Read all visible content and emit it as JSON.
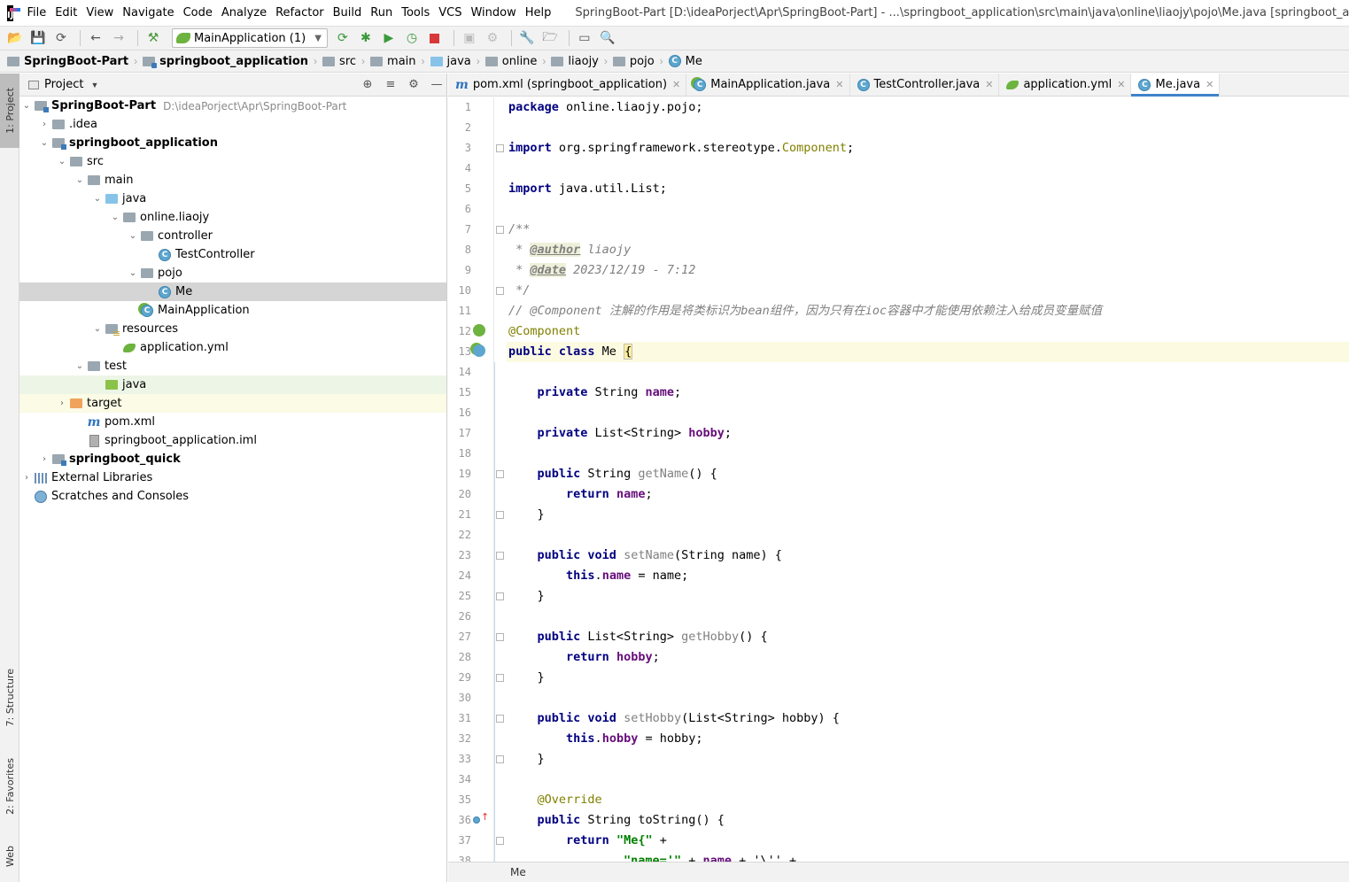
{
  "app": {
    "logo_text": "IJ",
    "window_title": "SpringBoot-Part [D:\\ideaPorject\\Apr\\SpringBoot-Part] - ...\\springboot_application\\src\\main\\java\\online\\liaojy\\pojo\\Me.java [springboot_application] - In"
  },
  "menu": [
    "File",
    "Edit",
    "View",
    "Navigate",
    "Code",
    "Analyze",
    "Refactor",
    "Build",
    "Run",
    "Tools",
    "VCS",
    "Window",
    "Help"
  ],
  "toolbar": {
    "run_config": "MainApplication (1)",
    "icons": [
      "open-icon",
      "save-icon",
      "sync-icon",
      "back-icon",
      "forward-icon",
      "build-icon",
      "run-icon",
      "debug-icon",
      "coverage-icon",
      "profile-icon",
      "stop-icon",
      "attach-icon",
      "sdk-icon",
      "settings-icon",
      "structure-icon",
      "terminal-icon",
      "search-icon"
    ]
  },
  "breadcrumb": [
    "SpringBoot-Part",
    "springboot_application",
    "src",
    "main",
    "java",
    "online",
    "liaojy",
    "pojo",
    "Me"
  ],
  "left_stripe": {
    "project": "1: Project",
    "structure": "7: Structure",
    "favorites": "2: Favorites",
    "web": "Web"
  },
  "project_panel": {
    "title": "Project",
    "tree": [
      {
        "label": "SpringBoot-Part",
        "path": "D:\\ideaPorject\\Apr\\SpringBoot-Part",
        "bold": true
      },
      {
        "label": ".idea"
      },
      {
        "label": "springboot_application",
        "bold": true
      },
      {
        "label": "src"
      },
      {
        "label": "main"
      },
      {
        "label": "java"
      },
      {
        "label": "online.liaojy"
      },
      {
        "label": "controller"
      },
      {
        "label": "TestController"
      },
      {
        "label": "pojo"
      },
      {
        "label": "Me"
      },
      {
        "label": "MainApplication"
      },
      {
        "label": "resources"
      },
      {
        "label": "application.yml"
      },
      {
        "label": "test"
      },
      {
        "label": "java"
      },
      {
        "label": "target"
      },
      {
        "label": "pom.xml"
      },
      {
        "label": "springboot_application.iml"
      },
      {
        "label": "springboot_quick",
        "bold": true
      },
      {
        "label": "External Libraries"
      },
      {
        "label": "Scratches and Consoles"
      }
    ]
  },
  "tabs": [
    {
      "label": "pom.xml (springboot_application)",
      "icon": "maven-icon"
    },
    {
      "label": "MainApplication.java",
      "icon": "spring-class-icon"
    },
    {
      "label": "TestController.java",
      "icon": "class-icon"
    },
    {
      "label": "application.yml",
      "icon": "yaml-icon"
    },
    {
      "label": "Me.java",
      "icon": "class-icon",
      "active": true
    }
  ],
  "code": {
    "l1": "package",
    "l1b": " online.liaojy.pojo;",
    "l3a": "import",
    "l3b": " org.springframework.stereotype.",
    "l3c": "Component",
    "l3d": ";",
    "l5a": "import",
    "l5b": " java.util.List;",
    "l7": "/**",
    "l8a": " * ",
    "l8b": "@author",
    "l8c": " liaojy",
    "l9a": " * ",
    "l9b": "@date",
    "l9c": " 2023/12/19 - 7:12",
    "l10": " */",
    "l11": "// @Component 注解的作用是将类标识为bean组件，因为只有在ioc容器中才能使用依赖注入给成员变量赋值",
    "l12": "@Component",
    "l13a": "public class",
    "l13b": " Me ",
    "l13c": "{",
    "l15a": "private",
    "l15b": " String ",
    "l15c": "name",
    "l15d": ";",
    "l17a": "private",
    "l17b": " List<String> ",
    "l17c": "hobby",
    "l17d": ";",
    "l19a": "public",
    "l19b": " String ",
    "l19c": "getName",
    "l19d": "() {",
    "l20a": "return",
    "l20b": " ",
    "l20c": "name",
    "l20d": ";",
    "l21": "}",
    "l23a": "public void",
    "l23b": " ",
    "l23c": "setName",
    "l23d": "(String name) {",
    "l24a": "this",
    "l24b": ".",
    "l24c": "name",
    "l24d": " = name;",
    "l25": "}",
    "l27a": "public",
    "l27b": " List<String> ",
    "l27c": "getHobby",
    "l27d": "() {",
    "l28a": "return",
    "l28b": " ",
    "l28c": "hobby",
    "l28d": ";",
    "l29": "}",
    "l31a": "public void",
    "l31b": " ",
    "l31c": "setHobby",
    "l31d": "(List<String> hobby) {",
    "l32a": "this",
    "l32b": ".",
    "l32c": "hobby",
    "l32d": " = hobby;",
    "l33": "}",
    "l35": "@Override",
    "l36a": "public",
    "l36b": " String toString() {",
    "l37a": "return",
    "l37b": " ",
    "l37c": "\"Me{\"",
    "l37d": " +",
    "l38a": "\"name='\"",
    "l38b": " + ",
    "l38c": "name",
    "l38d": " + '\\'' +"
  },
  "line_numbers": [
    "1",
    "2",
    "3",
    "4",
    "5",
    "6",
    "7",
    "8",
    "9",
    "10",
    "11",
    "12",
    "13",
    "14",
    "15",
    "16",
    "17",
    "18",
    "19",
    "20",
    "21",
    "22",
    "23",
    "24",
    "25",
    "26",
    "27",
    "28",
    "29",
    "30",
    "31",
    "32",
    "33",
    "34",
    "35",
    "36",
    "37",
    "38"
  ],
  "status": {
    "breadcrumb": "Me"
  }
}
